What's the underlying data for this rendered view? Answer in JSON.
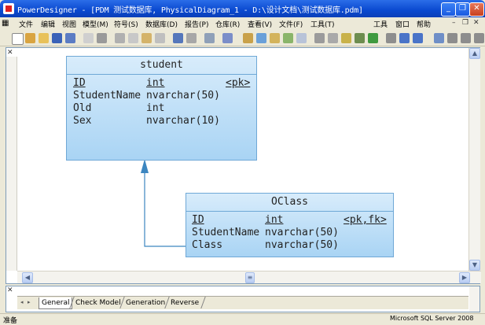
{
  "window": {
    "title": "PowerDesigner - [PDM 测试数据库, PhysicalDiagram_1 - D:\\设计文档\\测试数据库.pdm]",
    "minimize": "_",
    "restore": "❐",
    "close": "✕"
  },
  "menu": {
    "items": [
      "文件",
      "编辑",
      "视图",
      "模型(M)",
      "符号(S)",
      "数据库(D)",
      "报告(P)",
      "仓库(R)",
      "查看(V)",
      "文件(F)",
      "工具(T)",
      "工具",
      "窗口",
      "帮助"
    ],
    "mdi_minimize": "–",
    "mdi_restore": "❐",
    "mdi_close": "✕"
  },
  "diagram": {
    "tables": [
      {
        "name": "student",
        "columns": [
          {
            "name": "ID",
            "type": "int",
            "key": "<pk>"
          },
          {
            "name": "StudentName",
            "type": "nvarchar(50)",
            "key": ""
          },
          {
            "name": "Old",
            "type": "int",
            "key": ""
          },
          {
            "name": "Sex",
            "type": "nvarchar(10)",
            "key": ""
          }
        ]
      },
      {
        "name": "OClass",
        "columns": [
          {
            "name": "ID",
            "type": "int",
            "key": "<pk,fk>"
          },
          {
            "name": "StudentName",
            "type": "nvarchar(50)",
            "key": ""
          },
          {
            "name": "Class",
            "type": "nvarchar(50)",
            "key": ""
          }
        ]
      }
    ]
  },
  "output_panel": {
    "tabs": [
      "General",
      "Check Model",
      "Generation",
      "Reverse"
    ],
    "active_tab": "General"
  },
  "status": {
    "left": "准备",
    "right": "Microsoft SQL Server 2008"
  },
  "colors": {
    "titlebar": "#0a49d0",
    "table_fill_top": "#d8ecfb",
    "table_fill_bottom": "#a9d4f4",
    "table_border": "#6fa8d6",
    "reference_line": "#3c86c0"
  }
}
